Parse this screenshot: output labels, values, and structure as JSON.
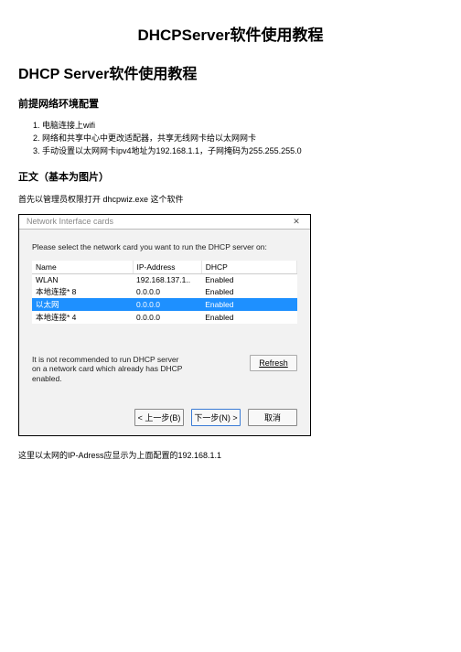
{
  "page_title": "DHCPServer软件使用教程",
  "heading1": "DHCP Server软件使用教程",
  "heading2": "前提网络环境配置",
  "prereq": [
    "电脑连接上wifi",
    "网络和共享中心中更改适配器，共享无线网卡给以太网网卡",
    "手动设置以太网网卡ipv4地址为192.168.1.1，子网掩码为255.255.255.0"
  ],
  "heading3": "正文（基本为图片）",
  "intro_line": "首先以管理员权限打开 dhcpwiz.exe 这个软件",
  "dialog": {
    "title": "Network Interface cards",
    "close_glyph": "✕",
    "instruction": "Please select the network card you want to run the DHCP server on:",
    "columns": {
      "name": "Name",
      "ip": "IP-Address",
      "dhcp": "DHCP"
    },
    "rows": [
      {
        "name": "WLAN",
        "ip": "192.168.137.1..",
        "dhcp": "Enabled",
        "selected": false
      },
      {
        "name": "本地连接* 8",
        "ip": "0.0.0.0",
        "dhcp": "Enabled",
        "selected": false
      },
      {
        "name": "以太网",
        "ip": "0.0.0.0",
        "dhcp": "Enabled",
        "selected": true
      },
      {
        "name": "本地连接* 4",
        "ip": "0.0.0.0",
        "dhcp": "Enabled",
        "selected": false
      }
    ],
    "note": "It is not recommended to run DHCP server on a network card which already has DHCP enabled.",
    "refresh": "Refresh",
    "back": "< 上一步(B)",
    "next": "下一步(N) >",
    "cancel": "取消"
  },
  "closing_line": "这里以太网的IP-Adress应显示为上面配置的192.168.1.1"
}
